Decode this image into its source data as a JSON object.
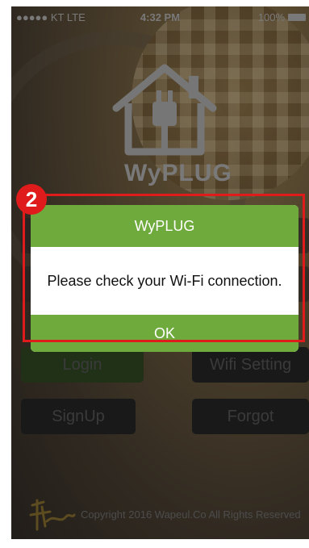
{
  "status_bar": {
    "carrier": "●●●●● KT  LTE",
    "time": "4:32 PM",
    "battery": "100%"
  },
  "app": {
    "logo_text": "WyPLUG"
  },
  "buttons": {
    "login": "Login",
    "wifi_setting": "Wifi Setting",
    "signup": "SignUp",
    "forgot": "Forgot"
  },
  "footer": {
    "copyright": "Copyright 2016 Wapeul.Co All Rights Reserved"
  },
  "annotation": {
    "badge": "2",
    "color": "#e01b1b"
  },
  "dialog": {
    "title": "WyPLUG",
    "message": "Please check your Wi-Fi connection.",
    "ok": "OK",
    "accent": "#6faa3c"
  }
}
